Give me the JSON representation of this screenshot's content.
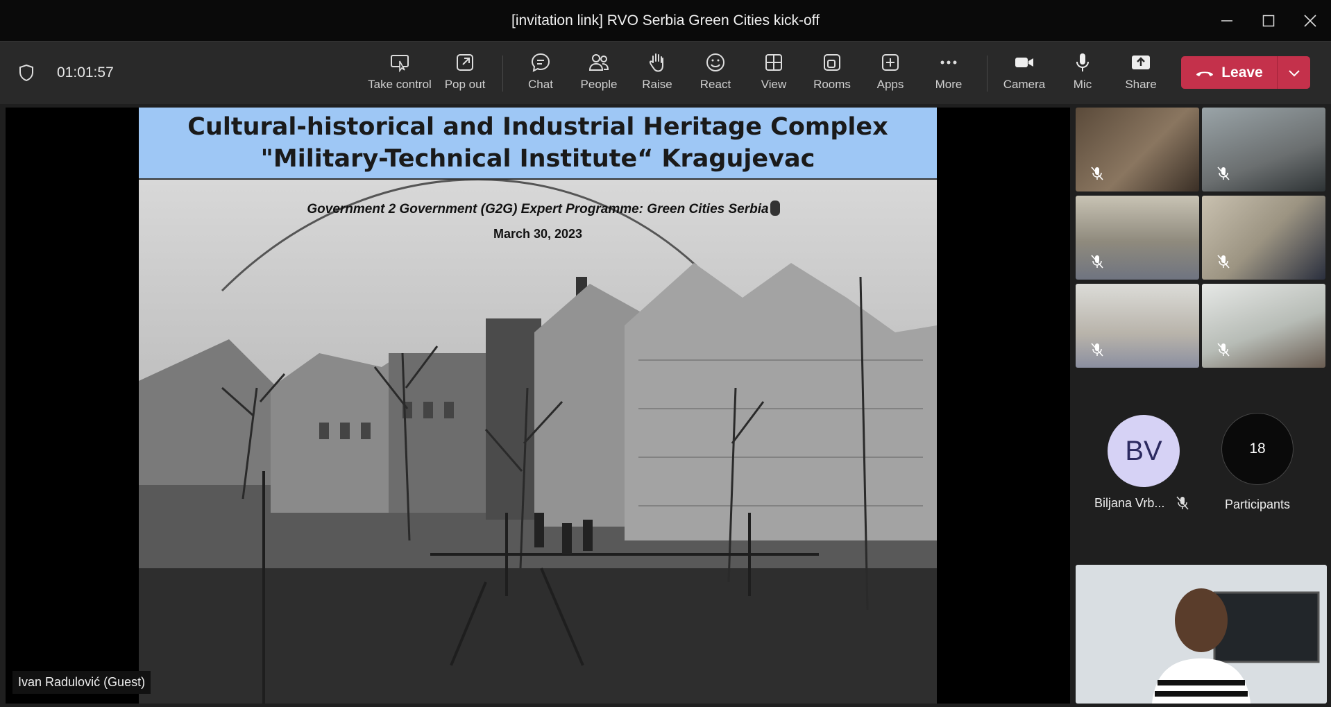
{
  "window": {
    "title": "[invitation link] RVO Serbia Green Cities kick-off"
  },
  "toolbar": {
    "timer": "01:01:57",
    "take_control": "Take control",
    "pop_out": "Pop out",
    "chat": "Chat",
    "people": "People",
    "raise": "Raise",
    "react": "React",
    "view": "View",
    "rooms": "Rooms",
    "apps": "Apps",
    "more": "More",
    "camera": "Camera",
    "mic": "Mic",
    "share": "Share",
    "leave": "Leave"
  },
  "slide": {
    "title_line1": "Cultural-historical and Industrial Heritage Complex",
    "title_line2": "\"Military-Technical Institute“ Kragujevac",
    "subtitle": "Government 2 Government (G2G) Expert Programme: Green Cities Serbia",
    "date": "March 30, 2023"
  },
  "presenter": {
    "name": "Ivan Radulović (Guest)"
  },
  "participants": {
    "bv_initials": "BV",
    "bv_name": "Biljana Vrb...",
    "count": "18",
    "count_label": "Participants"
  },
  "colors": {
    "leave": "#c4314b",
    "slide_header": "#9ec7f5",
    "avatar": "#d6d2f5"
  }
}
